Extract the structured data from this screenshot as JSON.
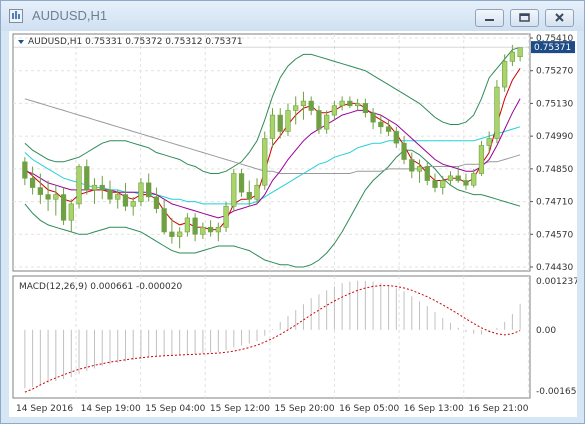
{
  "window": {
    "title": "AUDUSD,H1",
    "minimize_icon": "minimize-icon",
    "restore_icon": "restore-icon",
    "close_icon": "close-icon"
  },
  "main_chart": {
    "header": "AUDUSD,H1  0.75331 0.75372 0.75312 0.75371",
    "current_price": "0.75371",
    "price_labels": [
      "0.75410",
      "0.75270",
      "0.75130",
      "0.74990",
      "0.74850",
      "0.74710",
      "0.74570",
      "0.74430"
    ]
  },
  "macd_panel": {
    "header": "MACD(12,26,9) 0.000661 -0.000020",
    "labels": [
      "0.001237",
      "0.00",
      "-0.001653"
    ]
  },
  "time_axis": {
    "labels": [
      "14 Sep 2016",
      "14 Sep 19:00",
      "15 Sep 04:00",
      "15 Sep 12:00",
      "15 Sep 20:00",
      "16 Sep 05:00",
      "16 Sep 13:00",
      "16 Sep 21:00"
    ]
  },
  "colors": {
    "bull_candle": "#a8d46a",
    "bear_candle": "#6fa043",
    "bollinger": "#2e8b57",
    "ma_fast": "#cc0000",
    "ma_mid": "#990099",
    "ma_cyan": "#22d0d8",
    "ma_slow": "#999999",
    "macd_hist": "#c0c0c0",
    "macd_signal": "#cc0000"
  },
  "chart_data": {
    "type": "candlestick",
    "symbol": "AUDUSD",
    "timeframe": "H1",
    "price_range": [
      0.7443,
      0.7541
    ],
    "candles": [
      [
        0.7488,
        0.749,
        0.7478,
        0.7481
      ],
      [
        0.7481,
        0.7486,
        0.7474,
        0.7477
      ],
      [
        0.7477,
        0.7483,
        0.747,
        0.7474
      ],
      [
        0.7474,
        0.748,
        0.7467,
        0.7472
      ],
      [
        0.7472,
        0.7478,
        0.7465,
        0.7474
      ],
      [
        0.7474,
        0.7477,
        0.7461,
        0.7463
      ],
      [
        0.7463,
        0.7472,
        0.7458,
        0.747
      ],
      [
        0.747,
        0.7487,
        0.7468,
        0.7486
      ],
      [
        0.7486,
        0.7489,
        0.7474,
        0.7476
      ],
      [
        0.7476,
        0.7481,
        0.747,
        0.7478
      ],
      [
        0.7478,
        0.7482,
        0.7472,
        0.7476
      ],
      [
        0.7476,
        0.748,
        0.747,
        0.7472
      ],
      [
        0.7472,
        0.7476,
        0.7468,
        0.7474
      ],
      [
        0.7474,
        0.7479,
        0.7467,
        0.7469
      ],
      [
        0.7469,
        0.7473,
        0.7465,
        0.7471
      ],
      [
        0.7471,
        0.7481,
        0.7469,
        0.7479
      ],
      [
        0.7479,
        0.7483,
        0.7471,
        0.7473
      ],
      [
        0.7473,
        0.7477,
        0.7466,
        0.7468
      ],
      [
        0.7468,
        0.7472,
        0.7457,
        0.7458
      ],
      [
        0.7458,
        0.7464,
        0.7453,
        0.7456
      ],
      [
        0.7456,
        0.746,
        0.7451,
        0.7458
      ],
      [
        0.7458,
        0.7466,
        0.7456,
        0.7464
      ],
      [
        0.7464,
        0.7466,
        0.7454,
        0.7457
      ],
      [
        0.7457,
        0.7462,
        0.7455,
        0.746
      ],
      [
        0.746,
        0.7463,
        0.7456,
        0.7458
      ],
      [
        0.7458,
        0.7462,
        0.7454,
        0.746
      ],
      [
        0.746,
        0.7471,
        0.7458,
        0.7469
      ],
      [
        0.7469,
        0.7485,
        0.7467,
        0.7483
      ],
      [
        0.7483,
        0.7485,
        0.7473,
        0.7475
      ],
      [
        0.7475,
        0.748,
        0.7469,
        0.7472
      ],
      [
        0.7472,
        0.7481,
        0.747,
        0.7478
      ],
      [
        0.7478,
        0.7501,
        0.7476,
        0.7498
      ],
      [
        0.7498,
        0.7511,
        0.7494,
        0.7508
      ],
      [
        0.7508,
        0.7511,
        0.7498,
        0.7501
      ],
      [
        0.7501,
        0.7513,
        0.7499,
        0.751
      ],
      [
        0.751,
        0.7516,
        0.7504,
        0.7512
      ],
      [
        0.7512,
        0.7518,
        0.7506,
        0.7514
      ],
      [
        0.7514,
        0.7516,
        0.7508,
        0.751
      ],
      [
        0.751,
        0.7512,
        0.75,
        0.7502
      ],
      [
        0.7502,
        0.751,
        0.75,
        0.7508
      ],
      [
        0.7508,
        0.7514,
        0.7506,
        0.7512
      ],
      [
        0.7512,
        0.7516,
        0.751,
        0.7514
      ],
      [
        0.7514,
        0.7516,
        0.7511,
        0.7512
      ],
      [
        0.7512,
        0.7515,
        0.751,
        0.7513
      ],
      [
        0.7513,
        0.7515,
        0.7507,
        0.7509
      ],
      [
        0.7509,
        0.7511,
        0.7502,
        0.7505
      ],
      [
        0.7505,
        0.7508,
        0.75,
        0.7503
      ],
      [
        0.7503,
        0.7506,
        0.7499,
        0.7501
      ],
      [
        0.7501,
        0.7503,
        0.7494,
        0.7496
      ],
      [
        0.7496,
        0.7499,
        0.7487,
        0.7489
      ],
      [
        0.7489,
        0.7492,
        0.7481,
        0.7484
      ],
      [
        0.7484,
        0.7489,
        0.7479,
        0.7486
      ],
      [
        0.7486,
        0.7488,
        0.7478,
        0.748
      ],
      [
        0.748,
        0.7483,
        0.7475,
        0.7477
      ],
      [
        0.7477,
        0.7482,
        0.7474,
        0.748
      ],
      [
        0.748,
        0.7484,
        0.7478,
        0.7482
      ],
      [
        0.7482,
        0.7486,
        0.7479,
        0.748
      ],
      [
        0.748,
        0.7483,
        0.7476,
        0.7478
      ],
      [
        0.7478,
        0.7485,
        0.7477,
        0.7483
      ],
      [
        0.7483,
        0.7497,
        0.7482,
        0.7495
      ],
      [
        0.7495,
        0.7501,
        0.7492,
        0.7498
      ],
      [
        0.7498,
        0.7523,
        0.7496,
        0.752
      ],
      [
        0.752,
        0.7534,
        0.7518,
        0.7531
      ],
      [
        0.7531,
        0.7538,
        0.7529,
        0.7535
      ],
      [
        0.7533,
        0.7537,
        0.7531,
        0.7537
      ]
    ],
    "bollinger": {
      "upper": [
        0.7496,
        0.7493,
        0.7491,
        0.7489,
        0.7488,
        0.7488,
        0.7489,
        0.749,
        0.7492,
        0.7494,
        0.7496,
        0.7497,
        0.7497,
        0.7497,
        0.7496,
        0.7495,
        0.7494,
        0.7492,
        0.7491,
        0.749,
        0.7489,
        0.7487,
        0.7486,
        0.7484,
        0.7483,
        0.7483,
        0.7484,
        0.7486,
        0.7488,
        0.7492,
        0.7497,
        0.7506,
        0.7516,
        0.7524,
        0.7529,
        0.7532,
        0.7534,
        0.7534,
        0.7533,
        0.7532,
        0.7531,
        0.753,
        0.7529,
        0.7528,
        0.7527,
        0.7525,
        0.7523,
        0.7521,
        0.7519,
        0.7517,
        0.7515,
        0.7513,
        0.751,
        0.7507,
        0.7505,
        0.7504,
        0.7504,
        0.7505,
        0.7508,
        0.7515,
        0.7524,
        0.7528,
        0.7532,
        0.7536,
        0.7537
      ],
      "lower": [
        0.747,
        0.7466,
        0.7463,
        0.7461,
        0.746,
        0.7459,
        0.7458,
        0.7457,
        0.7457,
        0.7458,
        0.7459,
        0.746,
        0.746,
        0.746,
        0.7459,
        0.7458,
        0.7456,
        0.7454,
        0.7452,
        0.745,
        0.7449,
        0.7449,
        0.7449,
        0.745,
        0.7451,
        0.7452,
        0.7452,
        0.7452,
        0.7451,
        0.745,
        0.7448,
        0.7446,
        0.7445,
        0.7444,
        0.7444,
        0.7443,
        0.7443,
        0.7444,
        0.7446,
        0.7449,
        0.7453,
        0.7458,
        0.7464,
        0.747,
        0.7476,
        0.748,
        0.7483,
        0.7486,
        0.749,
        0.7493,
        0.7493,
        0.7491,
        0.7488,
        0.7485,
        0.7481,
        0.7478,
        0.7476,
        0.7475,
        0.7474,
        0.7474,
        0.7473,
        0.7472,
        0.7471,
        0.747,
        0.7469
      ]
    },
    "ma_fast": [
      0.7485,
      0.7482,
      0.7479,
      0.7476,
      0.7475,
      0.7472,
      0.7471,
      0.7474,
      0.7475,
      0.7476,
      0.7476,
      0.7475,
      0.7475,
      0.7473,
      0.7472,
      0.7474,
      0.7474,
      0.7472,
      0.7467,
      0.7463,
      0.7461,
      0.7462,
      0.746,
      0.746,
      0.7459,
      0.7459,
      0.7463,
      0.747,
      0.7472,
      0.7472,
      0.7474,
      0.7484,
      0.7495,
      0.7499,
      0.7504,
      0.7508,
      0.7511,
      0.7512,
      0.7509,
      0.7509,
      0.751,
      0.7512,
      0.7513,
      0.7513,
      0.7511,
      0.7508,
      0.7506,
      0.7504,
      0.75,
      0.7495,
      0.7489,
      0.7487,
      0.7483,
      0.748,
      0.748,
      0.7481,
      0.7481,
      0.7479,
      0.7481,
      0.7487,
      0.7492,
      0.7504,
      0.7515,
      0.7523,
      0.7528
    ],
    "ma_mid": [
      0.7484,
      0.7483,
      0.7481,
      0.7479,
      0.7478,
      0.7477,
      0.7476,
      0.7476,
      0.7476,
      0.7476,
      0.7476,
      0.7476,
      0.7475,
      0.7475,
      0.7475,
      0.7475,
      0.7475,
      0.7474,
      0.7472,
      0.747,
      0.7469,
      0.7468,
      0.7467,
      0.7466,
      0.7465,
      0.7464,
      0.7465,
      0.7467,
      0.7468,
      0.7469,
      0.747,
      0.7474,
      0.748,
      0.7484,
      0.7489,
      0.7493,
      0.7497,
      0.75,
      0.7502,
      0.7504,
      0.7506,
      0.7508,
      0.7509,
      0.751,
      0.751,
      0.7509,
      0.7508,
      0.7506,
      0.7504,
      0.7501,
      0.7498,
      0.7495,
      0.7492,
      0.7489,
      0.7487,
      0.7486,
      0.7485,
      0.7484,
      0.7484,
      0.7486,
      0.7489,
      0.7495,
      0.7502,
      0.7509,
      0.7515
    ],
    "ma_cyan": [
      0.7492,
      0.7489,
      0.7487,
      0.7485,
      0.7483,
      0.7481,
      0.748,
      0.7479,
      0.7478,
      0.7477,
      0.7477,
      0.7476,
      0.7476,
      0.7475,
      0.7475,
      0.7474,
      0.7474,
      0.7474,
      0.7473,
      0.7472,
      0.7472,
      0.7471,
      0.7471,
      0.747,
      0.747,
      0.747,
      0.747,
      0.747,
      0.747,
      0.747,
      0.7471,
      0.7473,
      0.7475,
      0.7477,
      0.7479,
      0.7481,
      0.7483,
      0.7485,
      0.7487,
      0.7488,
      0.749,
      0.7491,
      0.7492,
      0.7494,
      0.7495,
      0.7496,
      0.7496,
      0.7497,
      0.7497,
      0.7497,
      0.7497,
      0.7497,
      0.7497,
      0.7497,
      0.7497,
      0.7497,
      0.7497,
      0.7497,
      0.7497,
      0.7498,
      0.7499,
      0.75,
      0.7501,
      0.7502,
      0.7503
    ],
    "ma_slow": [
      0.7515,
      0.7514,
      0.7513,
      0.7512,
      0.7511,
      0.751,
      0.7509,
      0.7508,
      0.7507,
      0.7506,
      0.7505,
      0.7504,
      0.7503,
      0.7502,
      0.7501,
      0.75,
      0.7499,
      0.7498,
      0.7497,
      0.7496,
      0.7495,
      0.7494,
      0.7493,
      0.7492,
      0.7491,
      0.749,
      0.7489,
      0.7488,
      0.7487,
      0.7486,
      0.7485,
      0.7484,
      0.7484,
      0.7483,
      0.7483,
      0.7483,
      0.7483,
      0.7483,
      0.7483,
      0.7483,
      0.7483,
      0.7483,
      0.7483,
      0.7484,
      0.7484,
      0.7484,
      0.7484,
      0.7485,
      0.7485,
      0.7485,
      0.7485,
      0.7485,
      0.7486,
      0.7486,
      0.7486,
      0.7486,
      0.7486,
      0.7487,
      0.7487,
      0.7487,
      0.7488,
      0.7488,
      0.7489,
      0.749,
      0.7491
    ],
    "macd_range": [
      -0.001653,
      0.001237
    ],
    "macd_hist": [
      -0.00148,
      -0.00145,
      -0.0014,
      -0.00135,
      -0.0013,
      -0.00125,
      -0.0012,
      -0.00112,
      -0.00105,
      -0.00098,
      -0.00092,
      -0.00088,
      -0.00084,
      -0.0008,
      -0.00077,
      -0.00074,
      -0.0007,
      -0.00067,
      -0.00066,
      -0.00066,
      -0.00065,
      -0.00062,
      -0.00061,
      -0.00059,
      -0.00058,
      -0.00056,
      -0.00052,
      -0.00045,
      -0.0004,
      -0.00035,
      -0.00028,
      -0.00015,
      2e-05,
      0.0002,
      0.00035,
      0.0005,
      0.00065,
      0.0008,
      0.0009,
      0.001,
      0.0011,
      0.00118,
      0.00122,
      0.00124,
      0.00124,
      0.00122,
      0.00118,
      0.00112,
      0.00105,
      0.00098,
      0.00085,
      0.00072,
      0.0006,
      0.00045,
      0.0003,
      0.00018,
      5e-05,
      -5e-05,
      -0.0001,
      -0.00012,
      -5e-05,
      5e-05,
      0.0002,
      0.0004,
      0.00066
    ],
    "macd_signal": [
      -0.00158,
      -0.0015,
      -0.0014,
      -0.0013,
      -0.00122,
      -0.00114,
      -0.00107,
      -0.001,
      -0.00095,
      -0.0009,
      -0.00086,
      -0.00082,
      -0.00079,
      -0.00076,
      -0.00073,
      -0.00071,
      -0.00069,
      -0.00067,
      -0.00066,
      -0.00065,
      -0.00064,
      -0.00063,
      -0.00062,
      -0.00061,
      -0.0006,
      -0.00059,
      -0.00057,
      -0.00054,
      -0.0005,
      -0.00045,
      -0.00039,
      -0.00031,
      -0.00022,
      -0.00012,
      0.0,
      0.00012,
      0.00025,
      0.00038,
      0.0005,
      0.00062,
      0.00073,
      0.00083,
      0.00092,
      0.001,
      0.00106,
      0.0011,
      0.00112,
      0.00112,
      0.0011,
      0.00106,
      0.001,
      0.00092,
      0.00084,
      0.00074,
      0.00063,
      0.00052,
      0.0004,
      0.00028,
      0.00016,
      5e-05,
      -4e-05,
      -0.0001,
      -0.00013,
      -0.0001,
      -2e-05
    ]
  }
}
